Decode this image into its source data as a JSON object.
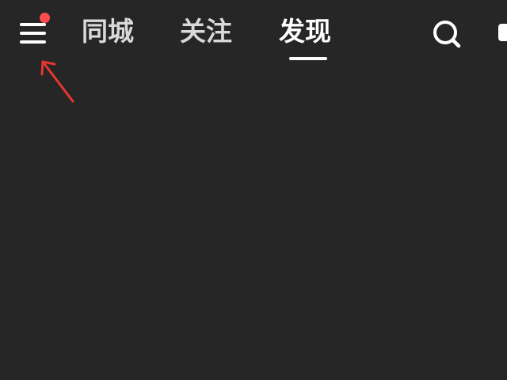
{
  "header": {
    "menu": {
      "icon": "menu-icon",
      "has_notification": true,
      "notification_color": "#ff4d4f"
    },
    "tabs": [
      {
        "label": "同城",
        "active": false
      },
      {
        "label": "关注",
        "active": false
      },
      {
        "label": "发现",
        "active": true
      }
    ],
    "search_icon": "search-icon",
    "edge_icon": "partial-icon"
  },
  "annotation": {
    "type": "arrow",
    "color": "#e8362f"
  },
  "colors": {
    "background": "#262626",
    "text_active": "#ffffff",
    "text_inactive": "#d9d9d9"
  }
}
